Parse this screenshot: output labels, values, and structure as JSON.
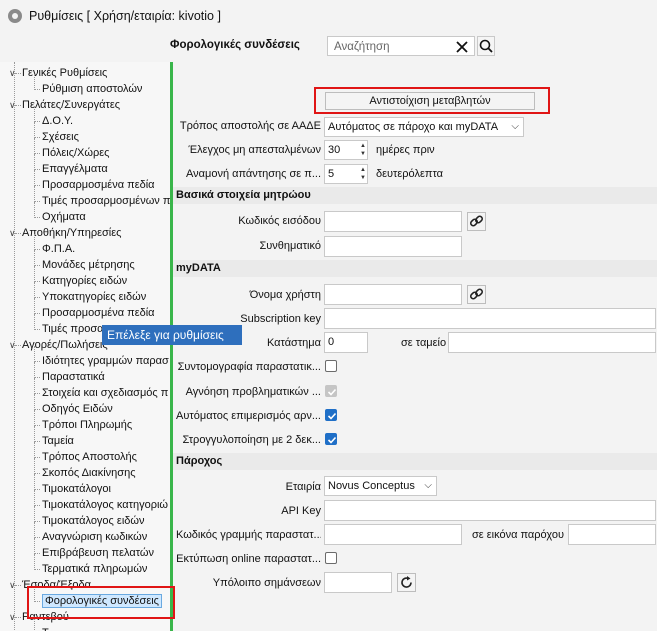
{
  "window": {
    "title": "Ρυθμίσεις   [ Χρήση/εταιρία: kivotio ]"
  },
  "header": {
    "title": "Φορολογικές συνδέσεις",
    "search_placeholder": "Αναζήτηση"
  },
  "tooltip": "Επέλεξε για ρυθμίσεις",
  "tree": [
    {
      "label": "Γενικές Ρυθμίσεις",
      "level": 0,
      "expanded": true
    },
    {
      "label": "Ρύθμιση αποστολών",
      "level": 1
    },
    {
      "label": "Πελάτες/Συνεργάτες",
      "level": 0,
      "expanded": true
    },
    {
      "label": "Δ.Ο.Υ.",
      "level": 1
    },
    {
      "label": "Σχέσεις",
      "level": 1
    },
    {
      "label": "Πόλεις/Χώρες",
      "level": 1
    },
    {
      "label": "Επαγγέλματα",
      "level": 1
    },
    {
      "label": "Προσαρμοσμένα πεδία",
      "level": 1
    },
    {
      "label": "Τιμές προσαρμοσμένων π",
      "level": 1
    },
    {
      "label": "Οχήματα",
      "level": 1
    },
    {
      "label": "Αποθήκη/Υπηρεσίες",
      "level": 0,
      "expanded": true
    },
    {
      "label": "Φ.Π.Α.",
      "level": 1
    },
    {
      "label": "Μονάδες μέτρησης",
      "level": 1
    },
    {
      "label": "Κατηγορίες ειδών",
      "level": 1
    },
    {
      "label": "Υποκατηγορίες ειδών",
      "level": 1
    },
    {
      "label": "Προσαρμοσμένα πεδία",
      "level": 1
    },
    {
      "label": "Τιμές προσα",
      "level": 1
    },
    {
      "label": "Αγορές/Πωλήσεις",
      "level": 0,
      "expanded": true
    },
    {
      "label": "Ιδιότητες γραμμών παρασ",
      "level": 1
    },
    {
      "label": "Παραστατικά",
      "level": 1
    },
    {
      "label": "Στοιχεία και σχεδιασμός π",
      "level": 1
    },
    {
      "label": "Οδηγός Ειδών",
      "level": 1
    },
    {
      "label": "Τρόποι Πληρωμής",
      "level": 1
    },
    {
      "label": "Ταμεία",
      "level": 1
    },
    {
      "label": "Τρόπος Αποστολής",
      "level": 1
    },
    {
      "label": "Σκοπός Διακίνησης",
      "level": 1
    },
    {
      "label": "Τιμοκατάλογοι",
      "level": 1
    },
    {
      "label": "Τιμοκατάλογος κατηγοριώ",
      "level": 1
    },
    {
      "label": "Τιμοκατάλογος ειδών",
      "level": 1
    },
    {
      "label": "Αναγνώριση κωδικών",
      "level": 1
    },
    {
      "label": "Επιβράβευση πελατών",
      "level": 1
    },
    {
      "label": "Τερματικά πληρωμών",
      "level": 1
    },
    {
      "label": "Έσοδα/Έξοδα",
      "level": 0,
      "expanded": true
    },
    {
      "label": "Φορολογικές συνδέσεις",
      "level": 1,
      "selected": true
    },
    {
      "label": "Ραντεβού",
      "level": 0,
      "expanded": true
    },
    {
      "label": "Τ...",
      "level": 1
    }
  ],
  "form": {
    "map_button": "Αντιστοίχιση μεταβλητών",
    "send_method": {
      "label": "Τρόπος αποστολής σε ΑΑΔΕ",
      "value": "Αυτόματος σε πάροχο και myDATA"
    },
    "check_unsent": {
      "label": "Έλεγχος μη απεσταλμένων",
      "value": "30",
      "unit": "ημέρες πριν"
    },
    "wait_reply": {
      "label": "Αναμονή απάντησης σε π...",
      "value": "5",
      "unit": "δευτερόλεπτα"
    },
    "registry_section": "Βασικά στοιχεία μητρώου",
    "login_code": {
      "label": "Κωδικός εισόδου",
      "value": ""
    },
    "password": {
      "label": "Συνθηματικό",
      "value": ""
    },
    "mydata_section": "myDATA",
    "username": {
      "label": "Όνομα χρήστη",
      "value": ""
    },
    "subscription_key": {
      "label": "Subscription key",
      "value": ""
    },
    "store": {
      "label": "Κατάστημα",
      "value": "0",
      "register_label": "σε ταμείο",
      "register_value": ""
    },
    "abbrev_docs": {
      "label": "Συντομογραφία παραστατικ...",
      "checked": false
    },
    "ignore_problematic": {
      "label": "Αγνόηση προβληματικών ...",
      "checked": true,
      "disabled": true
    },
    "auto_split_neg": {
      "label": "Αυτόματος επιμερισμός αρν...",
      "checked": true
    },
    "round_2dec": {
      "label": "Στρογγυλοποίηση με 2 δεκ...",
      "checked": true
    },
    "provider_section": "Πάροχος",
    "company": {
      "label": "Εταιρία",
      "value": "Novus Conceptus"
    },
    "api_key": {
      "label": "API Key",
      "value": ""
    },
    "doc_line_code": {
      "label": "Κωδικός γραμμής παραστατ...",
      "value": "",
      "image_label": "σε εικόνα παρόχου",
      "image_value": ""
    },
    "print_online": {
      "label": "Εκτύπωση online παραστατ...",
      "checked": false
    },
    "balance": {
      "label": "Υπόλοιπο σημάνσεων",
      "value": ""
    }
  },
  "colors": {
    "accent_green": "#39b54a",
    "highlight_red": "#e01515",
    "checkbox_blue": "#1f6fc7",
    "tooltip_blue": "#2e6fbd"
  }
}
